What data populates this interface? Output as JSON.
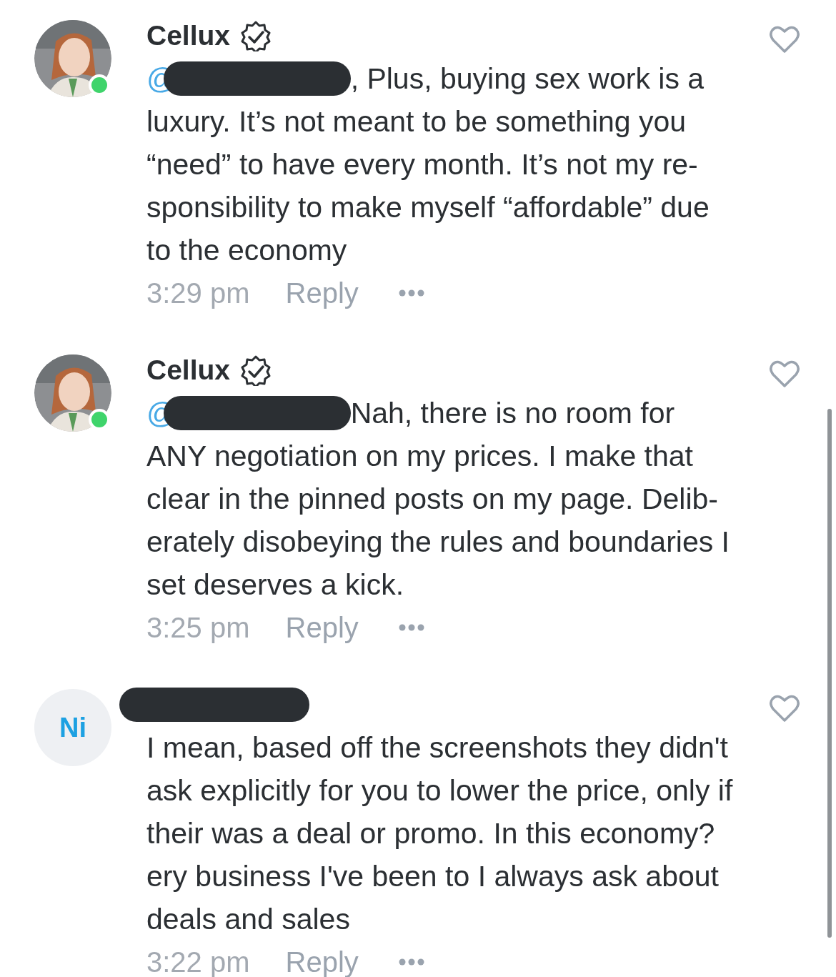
{
  "comments": [
    {
      "avatar": {
        "kind": "picture",
        "online": true
      },
      "author": {
        "kind": "name",
        "text": "Cellux"
      },
      "verified": true,
      "mention": {
        "prefix": "@",
        "redacted": true
      },
      "text": ", Plus, buying sex work is a luxury. It’s not meant to be something you “need” to have every month. It’s not my re-sponsibility to make myself “affordable” due to the economy",
      "time": "3:29 pm",
      "reply": "Reply",
      "liked": false
    },
    {
      "avatar": {
        "kind": "picture",
        "online": true
      },
      "author": {
        "kind": "name",
        "text": "Cellux"
      },
      "verified": true,
      "mention": {
        "prefix": "@",
        "redacted": true
      },
      "text": "Nah, there is no room for ANY negotiation on my prices. I make that clear in the pinned posts on my page. Delib-erately disobeying the rules and boundaries I set deserves a kick.",
      "time": "3:25 pm",
      "reply": "Reply",
      "liked": false
    },
    {
      "avatar": {
        "kind": "initials",
        "text": "Ni",
        "online": false
      },
      "author": {
        "kind": "redacted"
      },
      "verified": false,
      "text": "I mean, based off the screenshots they didn't ask explicitly for you to lower the price, only if their was a deal or promo. In this economy?ery business I've been to I always ask about deals and sales",
      "time": "3:22 pm",
      "reply": "Reply",
      "liked": false
    }
  ]
}
